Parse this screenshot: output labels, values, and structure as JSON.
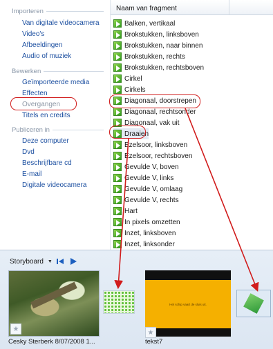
{
  "tasks": {
    "groups": [
      {
        "title": "Importeren",
        "items": [
          {
            "label": "Van digitale videocamera"
          },
          {
            "label": "Video's"
          },
          {
            "label": "Afbeeldingen"
          },
          {
            "label": "Audio of muziek"
          }
        ]
      },
      {
        "title": "Bewerken",
        "items": [
          {
            "label": "Geïmporteerde media"
          },
          {
            "label": "Effecten"
          },
          {
            "label": "Overgangen"
          },
          {
            "label": "Titels en credits"
          }
        ]
      },
      {
        "title": "Publiceren in",
        "items": [
          {
            "label": "Deze computer"
          },
          {
            "label": "Dvd"
          },
          {
            "label": "Beschrijfbare cd"
          },
          {
            "label": "E-mail"
          },
          {
            "label": "Digitale videocamera"
          }
        ]
      }
    ]
  },
  "collection": {
    "header": "Naam van fragment",
    "items": [
      "Balken, vertikaal",
      "Brokstukken, linksboven",
      "Brokstukken, naar binnen",
      "Brokstukken, rechts",
      "Brokstukken, rechtsboven",
      "Cirkel",
      "Cirkels",
      "Diagonaal, doorstrepen",
      "Diagonaal, rechtsonder",
      "Diagonaal, vak uit",
      "Draaien",
      "Ezelsoor, linksboven",
      "Ezelsoor, rechtsboven",
      "Gevulde V, boven",
      "Gevulde V, links",
      "Gevulde V, omlaag",
      "Gevulde V, rechts",
      "Hart",
      "In pixels omzetten",
      "Inzet, linksboven",
      "Inzet, linksonder"
    ]
  },
  "storyboard": {
    "label": "Storyboard",
    "caret_icon": "chevron-down-icon",
    "rewind_icon": "rewind-icon",
    "play_icon": "play-icon",
    "clips": [
      {
        "caption": "Cesky Sterberk 8/07/2008 1..."
      },
      {
        "caption": "tekst7",
        "slide_text": "Het schip vaart de sluis uit."
      }
    ]
  },
  "annotation_color": "#d11c1c",
  "link_color": "#1c4fa0"
}
